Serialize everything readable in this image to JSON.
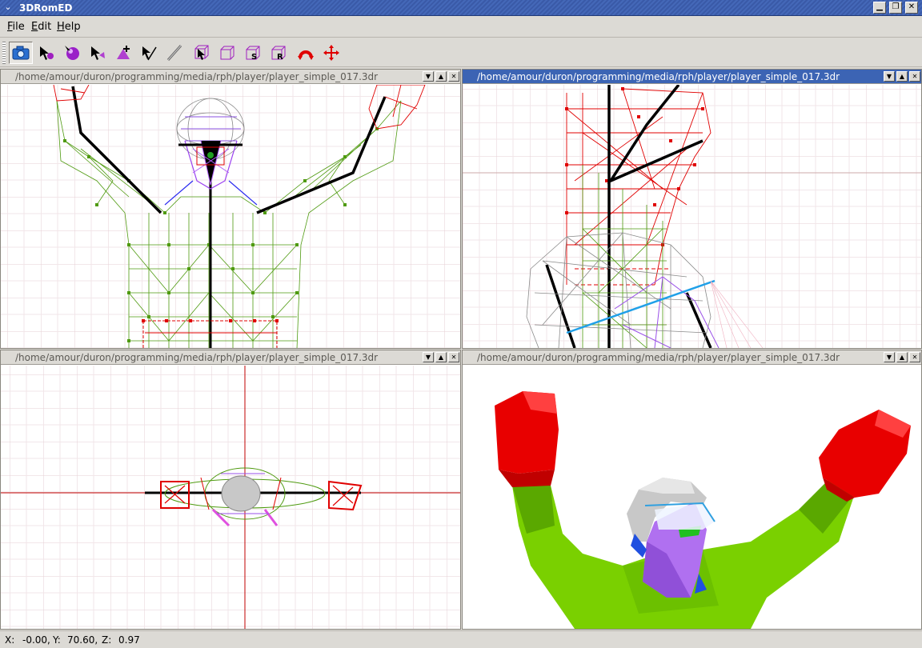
{
  "window": {
    "title": "3DRomED",
    "sysmenu_icon": "chevron-down-icon",
    "buttons": [
      "minimize-icon",
      "maximize-icon",
      "close-icon"
    ]
  },
  "menu": {
    "file": "File",
    "edit": "Edit",
    "help": "Help"
  },
  "toolbar": {
    "tools": [
      {
        "icon": "camera-icon"
      },
      {
        "icon": "select-vertex-icon"
      },
      {
        "icon": "select-sphere-icon"
      },
      {
        "icon": "select-point-icon"
      },
      {
        "icon": "add-triangle-icon"
      },
      {
        "icon": "select-edge-icon"
      },
      {
        "icon": "line-tool-icon"
      },
      {
        "icon": "select-box-icon"
      },
      {
        "icon": "box-tool-icon"
      },
      {
        "icon": "scale-tool-icon",
        "label": "S"
      },
      {
        "icon": "rotate-box-tool-icon",
        "label": "R"
      },
      {
        "icon": "rotate-arrow-icon"
      },
      {
        "icon": "move-arrows-icon"
      }
    ]
  },
  "viewports": [
    {
      "path": "/home/amour/duron/programming/media/rph/player/player_simple_017.3dr",
      "view": "front-wireframe"
    },
    {
      "path": "/home/amour/duron/programming/media/rph/player/player_simple_017.3dr",
      "view": "side-wireframe"
    },
    {
      "path": "/home/amour/duron/programming/media/rph/player/player_simple_017.3dr",
      "view": "top-wireframe"
    },
    {
      "path": "/home/amour/duron/programming/media/rph/player/player_simple_017.3dr",
      "view": "shaded-3d"
    }
  ],
  "pane_buttons": [
    "dropdown-icon",
    "maximize-pane-icon",
    "close-pane-icon"
  ],
  "status": {
    "x_label": "X:",
    "x": "-0.00,",
    "y_label": "Y:",
    "y": "70.60,",
    "z_label": "Z:",
    "z": "0.97"
  },
  "colors": {
    "title_active": "#3c64b4",
    "grid": "#e6cfd4",
    "axis": "#c00000",
    "skin_green": "#7ad000",
    "glove_red": "#e80000",
    "face_purple": "#b070f0",
    "helmet_gray": "#c8c8c8"
  }
}
